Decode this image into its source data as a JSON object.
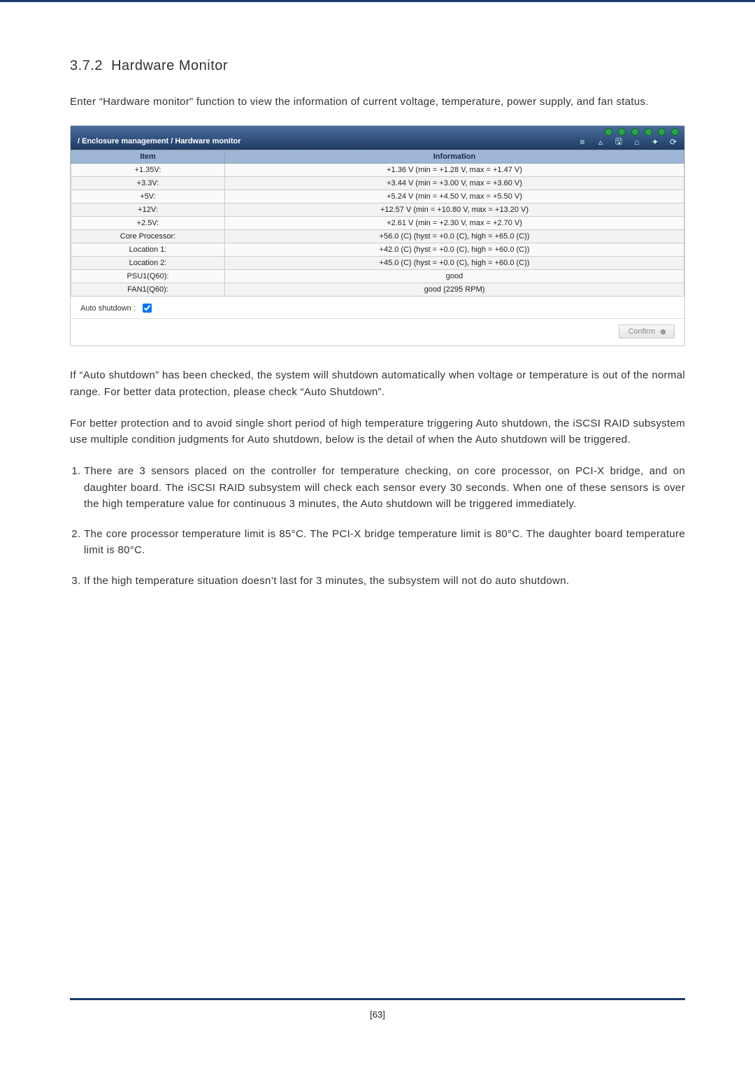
{
  "section": {
    "number": "3.7.2",
    "title": "Hardware Monitor"
  },
  "intro": "Enter “Hardware monitor” function to view the information of current voltage, temperature, power supply, and fan status.",
  "ui": {
    "breadcrumb": "/ Enclosure management / Hardware monitor",
    "columns": {
      "item": "Item",
      "info": "Information"
    },
    "rows": [
      {
        "item": "+1.35V:",
        "info": "+1.36 V (min = +1.28 V, max = +1.47 V)"
      },
      {
        "item": "+3.3V:",
        "info": "+3.44 V (min = +3.00 V, max = +3.60 V)"
      },
      {
        "item": "+5V:",
        "info": "+5.24 V (min = +4.50 V, max = +5.50 V)"
      },
      {
        "item": "+12V:",
        "info": "+12.57 V (min = +10.80 V, max = +13.20 V)"
      },
      {
        "item": "+2.5V:",
        "info": "+2.61 V (min = +2.30 V, max = +2.70 V)"
      },
      {
        "item": "Core Processor:",
        "info": "+56.0 (C) (hyst = +0.0 (C), high = +65.0 (C))"
      },
      {
        "item": "Location 1:",
        "info": "+42.0 (C) (hyst = +0.0 (C), high = +60.0 (C))"
      },
      {
        "item": "Location 2:",
        "info": "+45.0 (C) (hyst = +0.0 (C), high = +60.0 (C))"
      },
      {
        "item": "PSU1(Q60):",
        "info": "good"
      },
      {
        "item": "FAN1(Q60):",
        "info": "good (2295 RPM)"
      }
    ],
    "auto_shutdown_label": "Auto shutdown :",
    "auto_shutdown_checked": true,
    "confirm_label": "Confirm"
  },
  "para_after_ui": "If “Auto shutdown” has been checked, the system will shutdown automatically when voltage or temperature is out of the normal range. For better data protection, please check “Auto Shutdown”.",
  "para_protection": "For better protection and to avoid single short period of high temperature triggering Auto shutdown, the iSCSI RAID subsystem use multiple condition judgments for Auto shutdown, below is the detail of when the Auto shutdown will be triggered.",
  "list": [
    "There are 3 sensors placed on the controller for temperature checking, on core processor, on PCI-X bridge, and on daughter board. The iSCSI RAID subsystem will check each sensor every 30 seconds. When one of these sensors is over the high temperature value for continuous 3 minutes, the Auto shutdown will be triggered immediately.",
    "The core processor temperature limit is 85°C. The PCI-X bridge temperature limit is 80°C. The daughter board temperature limit is 80°C.",
    "If the high temperature situation doesn’t last for 3 minutes, the subsystem will not do auto shutdown."
  ],
  "page_number": "[63]"
}
